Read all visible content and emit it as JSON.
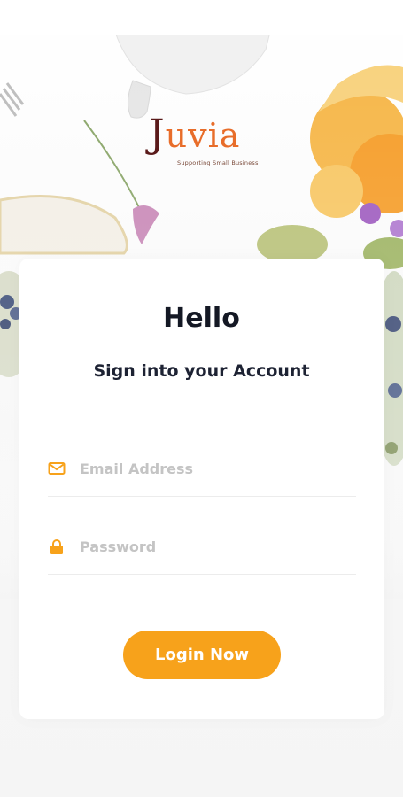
{
  "brand": {
    "name": "Juvia",
    "tagline": "Supporting Small Business"
  },
  "login": {
    "heading": "Hello",
    "subtitle": "Sign into your Account",
    "email_placeholder": "Email Address",
    "password_placeholder": "Password",
    "submit_label": "Login Now"
  },
  "icons": {
    "email": "envelope-icon",
    "password": "lock-icon"
  },
  "colors": {
    "accent": "#f7a21b",
    "logo_primary": "#e86d2a",
    "logo_initial": "#5a1a1a",
    "heading": "#141824",
    "placeholder": "#c4c4c4"
  }
}
